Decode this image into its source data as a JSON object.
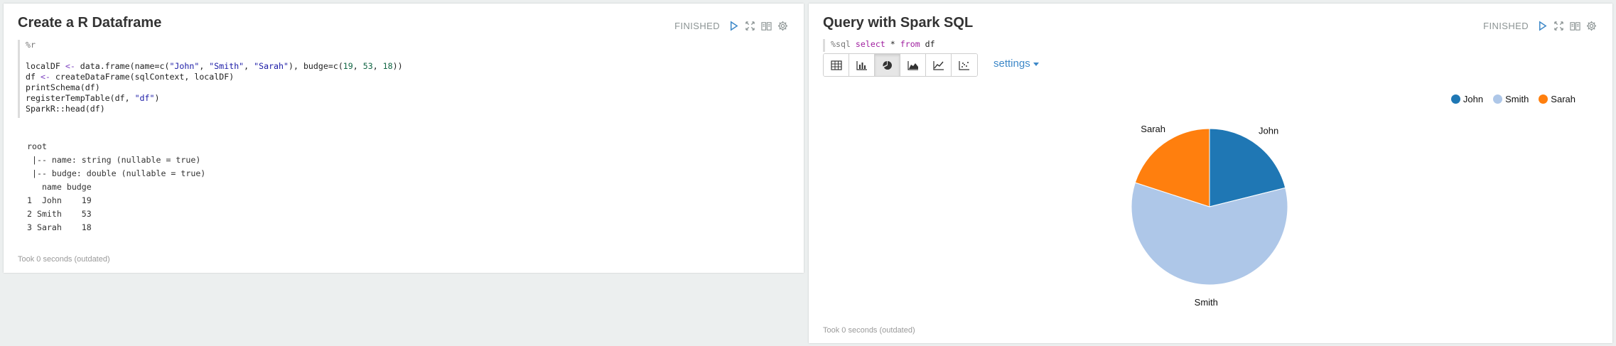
{
  "paragraph1": {
    "title": "Create a R Dataframe",
    "status": "FINISHED",
    "code_lines": [
      [
        {
          "t": "%r",
          "c": "dir"
        }
      ],
      [],
      [
        {
          "t": "localDF "
        },
        {
          "t": "<-",
          "c": "op"
        },
        {
          "t": " data.frame(name=c("
        },
        {
          "t": "\"John\"",
          "c": "str"
        },
        {
          "t": ", "
        },
        {
          "t": "\"Smith\"",
          "c": "str"
        },
        {
          "t": ", "
        },
        {
          "t": "\"Sarah\"",
          "c": "str"
        },
        {
          "t": "), budge=c("
        },
        {
          "t": "19",
          "c": "num"
        },
        {
          "t": ", "
        },
        {
          "t": "53",
          "c": "num"
        },
        {
          "t": ", "
        },
        {
          "t": "18",
          "c": "num"
        },
        {
          "t": "))"
        }
      ],
      [
        {
          "t": "df "
        },
        {
          "t": "<-",
          "c": "op"
        },
        {
          "t": " createDataFrame(sqlContext, localDF)"
        }
      ],
      [
        {
          "t": "printSchema(df)"
        }
      ],
      [
        {
          "t": "registerTempTable(df, "
        },
        {
          "t": "\"df\"",
          "c": "str"
        },
        {
          "t": ")"
        }
      ],
      [
        {
          "t": "SparkR::head(df)"
        }
      ]
    ],
    "output_lines": [
      "root",
      " |-- name: string (nullable = true)",
      " |-- budge: double (nullable = true)",
      "   name budge",
      "1  John    19",
      "2 Smith    53",
      "3 Sarah    18"
    ],
    "footer": "Took 0 seconds (outdated)"
  },
  "paragraph2": {
    "title": "Query with Spark SQL",
    "status": "FINISHED",
    "code_lines": [
      [
        {
          "t": "%sql",
          "c": "dir"
        },
        {
          "t": " "
        },
        {
          "t": "select",
          "c": "kw"
        },
        {
          "t": " * "
        },
        {
          "t": "from",
          "c": "kw"
        },
        {
          "t": " df"
        }
      ]
    ],
    "viz_buttons": [
      {
        "name": "table-view-button",
        "icon": "table-icon",
        "active": false
      },
      {
        "name": "bar-chart-button",
        "icon": "bar-chart-icon",
        "active": false
      },
      {
        "name": "pie-chart-button",
        "icon": "pie-chart-icon",
        "active": true
      },
      {
        "name": "area-chart-button",
        "icon": "area-chart-icon",
        "active": false
      },
      {
        "name": "line-chart-button",
        "icon": "line-chart-icon",
        "active": false
      },
      {
        "name": "scatter-chart-button",
        "icon": "scatter-chart-icon",
        "active": false
      }
    ],
    "settings_label": "settings",
    "footer": "Took 0 seconds (outdated)"
  },
  "chart_data": {
    "type": "pie",
    "categories": [
      "John",
      "Smith",
      "Sarah"
    ],
    "values": [
      19,
      53,
      18
    ],
    "colors": [
      "#1f77b4",
      "#aec7e8",
      "#ff7f0e"
    ],
    "title": "",
    "legend": "top-right"
  }
}
